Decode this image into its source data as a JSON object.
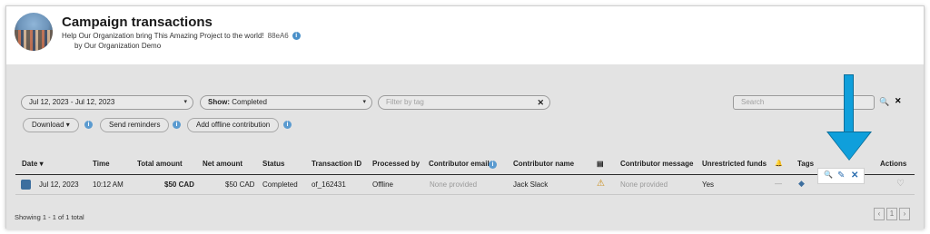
{
  "header": {
    "title": "Campaign transactions",
    "subtitle": "Help Our Organization bring This Amazing Project to the world!",
    "code": "88eA6",
    "byline": "by Our Organization Demo",
    "info_glyph": "i"
  },
  "filters": {
    "date_range": "Jul 12, 2023 - Jul 12, 2023",
    "show_label": "Show:",
    "show_value": "Completed",
    "tag_placeholder": "Filter by tag",
    "search_placeholder": "Search",
    "caret": "▾",
    "clear": "✕",
    "search_glyph": "🔍"
  },
  "toolbar": {
    "download_label": "Download ▾",
    "reminders_label": "Send reminders",
    "offline_label": "Add offline contribution",
    "info_glyph": "i"
  },
  "table": {
    "columns": {
      "date": "Date ▾",
      "time": "Time",
      "total": "Total amount",
      "net": "Net amount",
      "status": "Status",
      "txid": "Transaction ID",
      "processed": "Processed by",
      "email": "Contributor email",
      "name": "Contributor name",
      "card": "▤",
      "message": "Contributor message",
      "unrestricted": "Unrestricted funds",
      "bell": "🔔",
      "tags": "Tags",
      "actions": "Actions"
    },
    "row": {
      "date": "Jul 12, 2023",
      "time": "10:12 AM",
      "total": "$50 CAD",
      "net": "$50 CAD",
      "status": "Completed",
      "txid": "of_162431",
      "processed": "Offline",
      "email": "None provided",
      "name": "Jack Slack",
      "warning": "⚠",
      "message": "None provided",
      "unrestricted": "Yes",
      "bell": "—",
      "tag_glyph": "◆",
      "heart": "♡"
    }
  },
  "row_actions": {
    "view": "🔍",
    "edit": "✎",
    "delete": "✕"
  },
  "footer": {
    "showing": "Showing 1 - 1 of 1 total"
  },
  "pagination": {
    "prev": "‹",
    "page": "1",
    "next": "›"
  },
  "colors": {
    "accent": "#0f9fdb",
    "link": "#2d6fb0",
    "overlay": "#e3e3e3"
  }
}
